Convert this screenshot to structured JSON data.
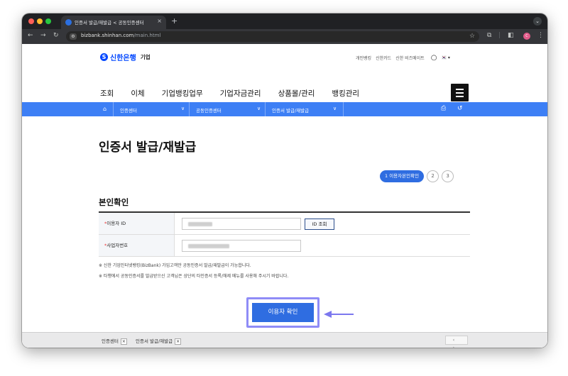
{
  "browser": {
    "tab_title": "인증서 발급/재발급 < 공동인증센터",
    "tab_close": "×",
    "new_tab": "+",
    "tab_menu": "⌄",
    "url_domain": "bizbank.shinhan.com",
    "url_path": "/main.html",
    "profile_initial": "C",
    "traffic_colors": [
      "#ff5f57",
      "#febc2e",
      "#28c840"
    ]
  },
  "header": {
    "logo_mark": "S",
    "logo_text": "신한은행",
    "logo_sub": "기업",
    "util_links": [
      "개인뱅킹",
      "신한카드",
      "신한 비즈메이트"
    ],
    "lang": "🇰🇷 ▾"
  },
  "gnb": [
    "조회",
    "이체",
    "기업뱅킹업무",
    "기업자금관리",
    "상품몰/관리",
    "뱅킹관리"
  ],
  "subnav": {
    "items": [
      {
        "label": "인증센터",
        "caret": "∨"
      },
      {
        "label": "공동인증센터",
        "caret": "∨"
      },
      {
        "label": "인증서 발급/재발급",
        "caret": "∨"
      }
    ]
  },
  "main": {
    "page_title": "인증서 발급/재발급",
    "steps": {
      "active": "1  이용자본인확인",
      "others": [
        "2",
        "3"
      ]
    },
    "section_title": "본인확인",
    "form": {
      "user_id_label": "이용자 ID",
      "id_check_button": "ID 조회",
      "biz_number_label": "사업자번호",
      "required_mark": "*"
    },
    "notes": [
      "※ 신한 기업인터넷뱅킹(BizBank) 가입고객만 공동인증서 발급/재발급이 가능합니다.",
      "※ 타행에서 공동인증서를 발급받으신 고객님은 상단의 타인증서 등록/해제 메뉴를 사용해 주시기 바랍니다."
    ],
    "confirm_button": "이용자 확인"
  },
  "footer": {
    "tabs": [
      "인증센터",
      "인증서 발급/재발급"
    ],
    "close_glyph": "×",
    "nav": "‹ ›"
  },
  "colors": {
    "brand": "#0046ff",
    "subnav": "#3d7ff5",
    "button": "#2f6de1",
    "highlight": "#8f8cf7"
  }
}
